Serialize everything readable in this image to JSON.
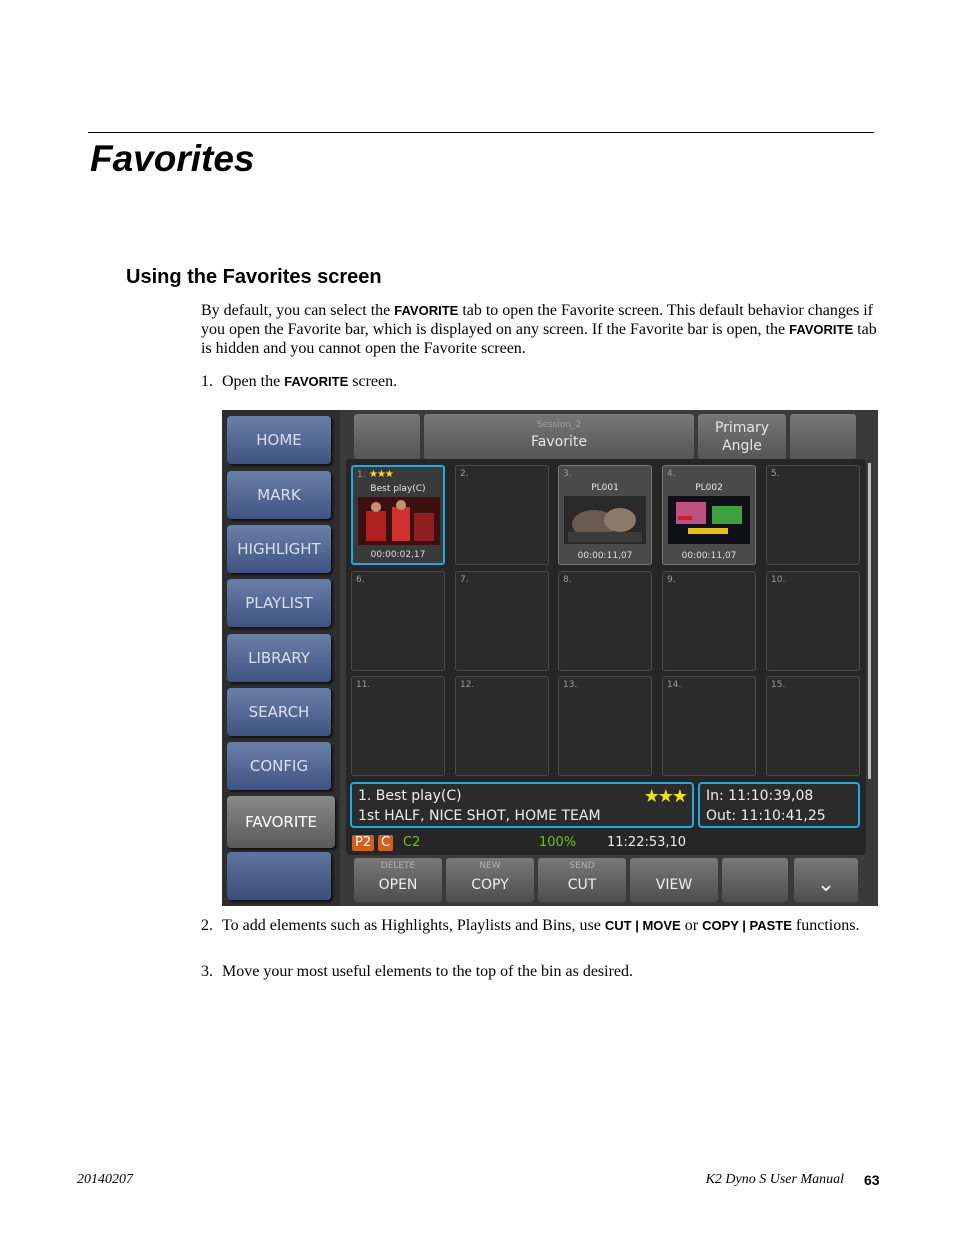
{
  "chapter_title": "Favorites",
  "section_title": "Using the Favorites screen",
  "intro": {
    "t1": "By default, you can select the ",
    "k1": "FAVORITE",
    "t2": " tab to open the Favorite screen. This default behavior changes if you open the Favorite bar, which is displayed on any screen. If the Favorite bar is open, the ",
    "k2": "FAVORITE",
    "t3": " tab is hidden and you cannot open the Favorite screen."
  },
  "steps": [
    {
      "num": "1.",
      "t1": "Open the ",
      "k1": "FAVORITE",
      "t2": " screen."
    },
    {
      "num": "2.",
      "t1": "To add elements such as Highlights, Playlists and Bins, use ",
      "k1": "CUT | MOVE",
      "t2": " or ",
      "k2": "COPY | PASTE",
      "t3": " functions."
    },
    {
      "num": "3.",
      "t1": "Move your most useful elements to the top of the bin as desired."
    }
  ],
  "screen": {
    "nav": [
      "HOME",
      "MARK",
      "HIGHLIGHT",
      "PLAYLIST",
      "LIBRARY",
      "SEARCH",
      "CONFIG",
      "FAVORITE"
    ],
    "top": {
      "session": "Session_2",
      "title": "Favorite",
      "angle1": "Primary",
      "angle2": "Angle"
    },
    "cells": [
      {
        "num": "1.",
        "stars": "★★★",
        "name": "Best play(C)",
        "tc": "00:00:02,17"
      },
      {
        "num": "2."
      },
      {
        "num": "3.",
        "name": "PL001",
        "tc": "00:00:11,07"
      },
      {
        "num": "4.",
        "name": "PL002",
        "tc": "00:00:11,07"
      },
      {
        "num": "5."
      },
      {
        "num": "6."
      },
      {
        "num": "7."
      },
      {
        "num": "8."
      },
      {
        "num": "9."
      },
      {
        "num": "10."
      },
      {
        "num": "11."
      },
      {
        "num": "12."
      },
      {
        "num": "13."
      },
      {
        "num": "14."
      },
      {
        "num": "15."
      }
    ],
    "info": {
      "line1": "1. Best play(C)",
      "line2": "1st HALF, NICE SHOT, HOME TEAM",
      "stars": "★★★",
      "in": "In:   11:10:39,08",
      "out": "Out: 11:10:41,25"
    },
    "status": {
      "p2": "P2",
      "c": "C",
      "c2": "C2",
      "pct": "100%",
      "tc": "11:22:53,10"
    },
    "buttons": [
      {
        "small": "DELETE",
        "label": "OPEN"
      },
      {
        "small": "NEW",
        "label": "COPY"
      },
      {
        "small": "SEND",
        "label": "CUT"
      },
      {
        "small": "",
        "label": "VIEW"
      },
      {
        "small": "",
        "label": ""
      },
      {
        "small": "",
        "label": "⌄"
      }
    ],
    "colors": {
      "selection": "#27a7e0",
      "stars": "#f0e020",
      "nav": "#4a5e8c"
    }
  },
  "footer": {
    "date": "20140207",
    "manual": "K2 Dyno S   User Manual",
    "page": "63"
  }
}
